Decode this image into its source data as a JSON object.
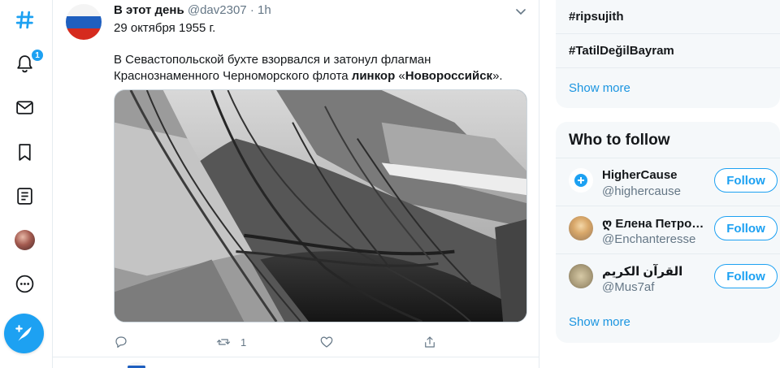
{
  "nav": {
    "items": [
      {
        "name": "explore-icon"
      },
      {
        "name": "notifications-icon",
        "badge": "1"
      },
      {
        "name": "messages-icon"
      },
      {
        "name": "bookmarks-icon"
      },
      {
        "name": "lists-icon"
      },
      {
        "name": "profile-avatar"
      },
      {
        "name": "more-icon"
      }
    ],
    "compose": {
      "name": "compose-tweet-icon"
    }
  },
  "tweet": {
    "author_name": "В этот день",
    "author_handle": "@dav2307",
    "separator": "·",
    "time": "1h",
    "date_line": "29 октября 1955 г.",
    "text_parts": {
      "p1": "В Севастопольской бухте взорвался и затонул флагман Краснознаменного Черноморского флота ",
      "bold1": "линкор",
      "p2": " «",
      "bold2": "Новороссийск",
      "p3": "»."
    },
    "actions": {
      "reply_count": "",
      "retweet_count": "1",
      "like_count": "",
      "share": ""
    }
  },
  "trends": {
    "items": [
      "#ripsujith",
      "#TatilDeğilBayram"
    ],
    "show_more": "Show more"
  },
  "who_to_follow": {
    "title": "Who to follow",
    "accounts": [
      {
        "name": "HigherCause",
        "handle": "@highercause",
        "button": "Follow"
      },
      {
        "name": "ღ Елена Петро…",
        "handle": "@Enchanteresse",
        "button": "Follow"
      },
      {
        "name": "القرآن الكريم",
        "handle": "@Mus7af",
        "button": "Follow"
      }
    ],
    "show_more": "Show more"
  },
  "colors": {
    "accent": "#1da1f2",
    "link": "#1b95e0",
    "text": "#14171a",
    "muted": "#657786",
    "panel": "#f5f8fa"
  }
}
